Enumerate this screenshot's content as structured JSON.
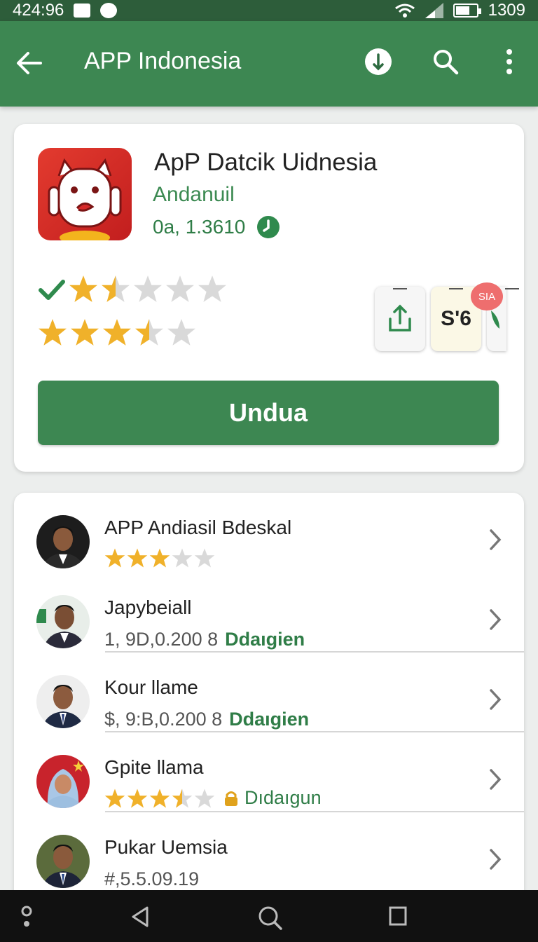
{
  "status_bar": {
    "time": "424:96",
    "right_text": "1309",
    "battery_level": 0.7
  },
  "app_bar": {
    "title": "APP Indonesia",
    "back_icon": "arrow-left-icon",
    "download_icon": "download-icon",
    "search_icon": "search-icon",
    "more_icon": "more-vert-icon"
  },
  "app": {
    "name": "ApP Datcik Uidnesia",
    "developer": "Andanuil",
    "version": "0a, 1.3610",
    "rating_top": 1.5,
    "rating_bottom": 3.5,
    "tile_share_icon": "share-icon",
    "tile_sis_label": "S'6",
    "badge": "SIA",
    "install_label": "Undua",
    "brand_color": "#3d8752",
    "accent_red": "#e33b2f"
  },
  "list": [
    {
      "title": "APP Andiasil Bdeskal",
      "type": "stars",
      "rating": 3
    },
    {
      "title": "Japybeiall",
      "subtitle": "1, 9D,0.200 8",
      "tag": "Ddaıgien"
    },
    {
      "title": "Kour llame",
      "subtitle": "$, 9:B,0.200 8",
      "tag": "Ddaıgien"
    },
    {
      "title": "Gpite llama",
      "type": "stars-tag",
      "rating": 3.5,
      "tag": "Dıdaıgun"
    },
    {
      "title": "Pukar Uemsia",
      "subtitle": "#,5.5.09.19"
    }
  ],
  "nav": {
    "items": [
      "assistant-icon",
      "back-triangle-icon",
      "home-search-icon",
      "recents-square-icon"
    ]
  }
}
